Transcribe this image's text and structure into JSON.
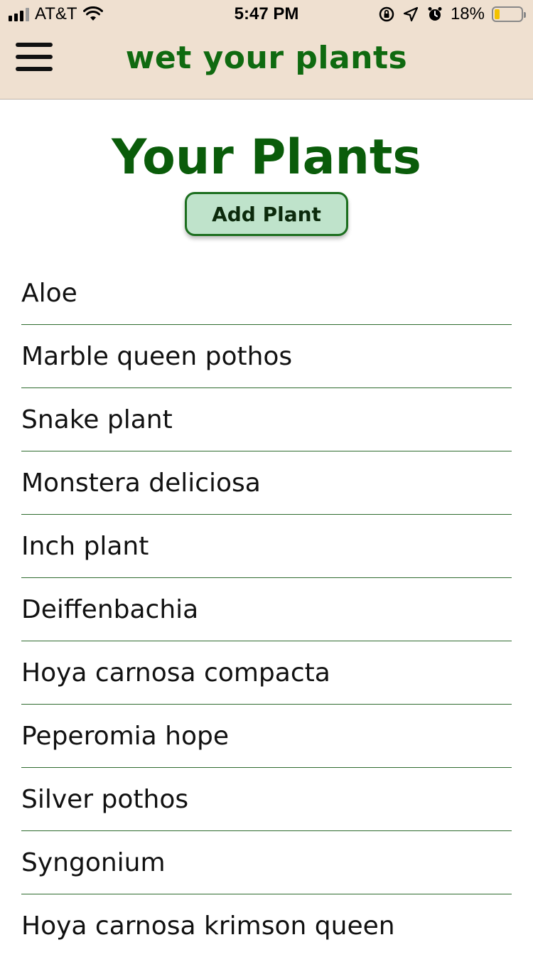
{
  "status_bar": {
    "carrier": "AT&T",
    "time": "5:47 PM",
    "battery_percent": "18%",
    "battery_level": 0.18,
    "icons": [
      "signal-icon",
      "wifi-icon",
      "rotation-lock-icon",
      "location-icon",
      "alarm-icon",
      "battery-icon"
    ]
  },
  "header": {
    "title": "wet your plants",
    "menu_icon": "hamburger-menu-icon"
  },
  "main": {
    "title": "Your Plants",
    "add_button_label": "Add Plant",
    "plants": [
      "Aloe",
      "Marble queen pothos",
      "Snake plant",
      "Monstera deliciosa",
      "Inch plant",
      "Deiffenbachia",
      "Hoya carnosa compacta",
      "Peperomia hope",
      "Silver pothos",
      "Syngonium",
      "Hoya carnosa krimson queen"
    ]
  },
  "colors": {
    "header_bg": "#efe0d0",
    "brand_green": "#0f6a10",
    "button_bg": "#bfe3cb",
    "button_border": "#1b6e1e",
    "divider": "#2e6b2e"
  }
}
